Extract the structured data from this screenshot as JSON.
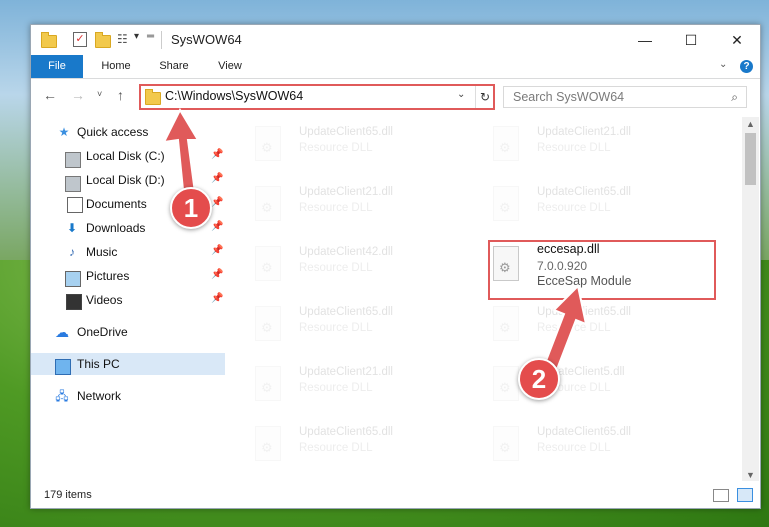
{
  "window": {
    "title": "SysWOW64",
    "controls": {
      "minimize": "—",
      "maximize": "☐",
      "close": "✕"
    }
  },
  "ribbon": {
    "tabs": [
      "File",
      "Home",
      "Share",
      "View"
    ],
    "help": "?"
  },
  "nav": {
    "address": "C:\\Windows\\SysWOW64",
    "search_placeholder": "Search SysWOW64"
  },
  "sidebar": {
    "items": [
      {
        "label": "Quick access",
        "icon": "star-icon"
      },
      {
        "label": "Local Disk (C:)",
        "icon": "drive-icon",
        "pinned": true
      },
      {
        "label": "Local Disk (D:)",
        "icon": "drive-icon",
        "pinned": true
      },
      {
        "label": "Documents",
        "icon": "document-icon",
        "pinned": true
      },
      {
        "label": "Downloads",
        "icon": "download-icon",
        "pinned": true
      },
      {
        "label": "Music",
        "icon": "music-icon",
        "pinned": true
      },
      {
        "label": "Pictures",
        "icon": "picture-icon",
        "pinned": true
      },
      {
        "label": "Videos",
        "icon": "video-icon",
        "pinned": true
      },
      {
        "label": "OneDrive",
        "icon": "cloud-icon"
      },
      {
        "label": "This PC",
        "icon": "computer-icon",
        "selected": true
      },
      {
        "label": "Network",
        "icon": "network-icon"
      }
    ]
  },
  "files": {
    "left": [
      {
        "name": "UpdateClient65.dll",
        "desc": "Resource DLL"
      },
      {
        "name": "UpdateClient21.dll",
        "desc": "Resource DLL"
      },
      {
        "name": "UpdateClient42.dll",
        "desc": "Resource DLL"
      },
      {
        "name": "UpdateClient65.dll",
        "desc": "Resource DLL"
      },
      {
        "name": "UpdateClient21.dll",
        "desc": "Resource DLL"
      },
      {
        "name": "UpdateClient65.dll",
        "desc": "Resource DLL"
      }
    ],
    "right": [
      {
        "name": "UpdateClient21.dll",
        "desc": "Resource DLL"
      },
      {
        "name": "UpdateClient65.dll",
        "desc": "Resource DLL"
      },
      {
        "name": "eccesap.dll",
        "version": "7.0.0.920",
        "desc": "EcceSap Module"
      },
      {
        "name": "UpdateClient65.dll",
        "desc": "Resource DLL"
      },
      {
        "name": "UpdateClient5.dll",
        "desc": "Resource DLL"
      },
      {
        "name": "UpdateClient65.dll",
        "desc": "Resource DLL"
      }
    ]
  },
  "status": {
    "count": "179 items"
  },
  "annotations": {
    "badge1": "1",
    "badge2": "2",
    "color": "#e05a5a"
  }
}
